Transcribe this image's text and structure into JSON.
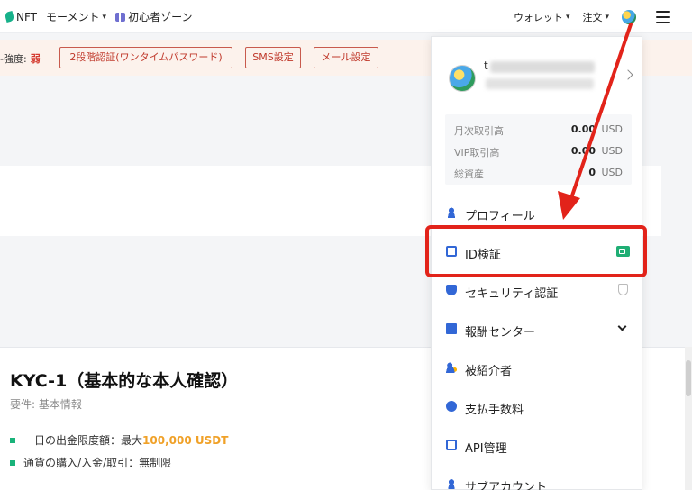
{
  "nav": {
    "nft": "NFT",
    "moments": "モーメント",
    "beginner_zone": "初心者ゾーン",
    "wallet": "ウォレット",
    "orders": "注文"
  },
  "security": {
    "strength_label": "-強度:",
    "strength_value": "弱",
    "buttons": [
      "2段階認証(ワンタイムパスワード)",
      "SMS設定",
      "メール設定"
    ]
  },
  "kyc": {
    "title": "KYC-1（基本的な本人確認）",
    "requirement": "要件: 基本情報",
    "withdraw_prefix": "一日の出金限度額：最大",
    "withdraw_amount": "100,000 USDT",
    "deposit_rule": "通貨の購入/入金/取引：無制限"
  },
  "dropdown": {
    "username_visible": "t",
    "stats": [
      {
        "label": "月次取引高",
        "value": "0.00",
        "unit": "USD"
      },
      {
        "label": "VIP取引高",
        "value": "0.00",
        "unit": "USD"
      },
      {
        "label": "総資産",
        "value": "0",
        "unit": "USD"
      }
    ],
    "menu": [
      {
        "label": "プロフィール",
        "icon": "user-icon"
      },
      {
        "label": "ID検証",
        "icon": "id-card-icon"
      },
      {
        "label": "セキュリティ認証",
        "icon": "shield-icon"
      },
      {
        "label": "報酬センター",
        "icon": "gift-icon"
      },
      {
        "label": "被紹介者",
        "icon": "referral-icon"
      },
      {
        "label": "支払手数料",
        "icon": "fee-icon"
      },
      {
        "label": "API管理",
        "icon": "api-icon"
      },
      {
        "label": "サブアカウント",
        "icon": "sub-account-icon"
      }
    ]
  },
  "annotation": {
    "color": "#e2231a"
  },
  "colors": {
    "accent_orange": "#f0a128",
    "kyc_green": "#19b37a",
    "alert_red": "#c0392b",
    "link_blue": "#3267d6"
  }
}
